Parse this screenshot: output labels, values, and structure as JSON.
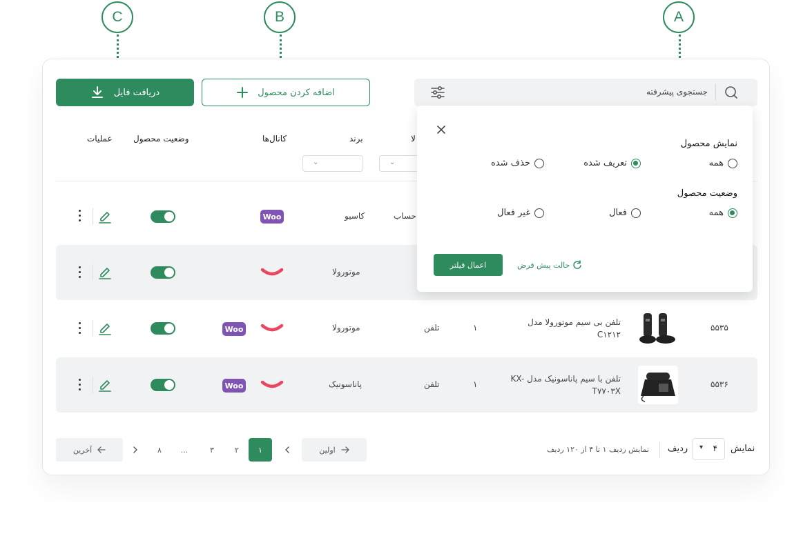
{
  "callouts": {
    "a": "A",
    "b": "B",
    "c": "C"
  },
  "toolbar": {
    "download_label": "دریافت فایل",
    "add_label": "اضافه کردن محصول",
    "search_placeholder": "جستجوی پیشرفته"
  },
  "columns": {
    "operations": "عملیات",
    "status": "وضعیت محصول",
    "channels": "کانال‌ها",
    "brand": "برند",
    "category_partial": "لا"
  },
  "rows": [
    {
      "code": "",
      "name": "",
      "count": "",
      "category": "حساب",
      "brand": "کاسیو",
      "channels": [
        "woocommerce"
      ]
    },
    {
      "code": "",
      "name": "",
      "count": "",
      "category": "",
      "brand": "موتورولا",
      "channels": [
        "smile"
      ]
    },
    {
      "code": "۵۵۳۵",
      "name": "تلفن بی سیم موتورولا مدل C۱۲۱۲",
      "count": "۱",
      "category": "تلفن",
      "brand": "موتورولا",
      "channels": [
        "smile",
        "woocommerce"
      ]
    },
    {
      "code": "۵۵۳۶",
      "name": "تلفن با سیم پاناسونیک مدل KX-T۷۷۰۳X",
      "count": "۱",
      "category": "تلفن",
      "brand": "پاناسونیک",
      "channels": [
        "smile",
        "woocommerce"
      ]
    }
  ],
  "filter": {
    "display_title": "نمایش محصول",
    "display_options": [
      "همه",
      "تعریف شده",
      "حذف شده"
    ],
    "display_selected": "تعریف شده",
    "status_title": "وضعیت محصول",
    "status_options": [
      "همه",
      "فعال",
      "غیر فعال"
    ],
    "status_selected": "همه",
    "apply_label": "اعمال فیلتر",
    "reset_label": "حالت پیش فرض"
  },
  "woo_text": "Woo",
  "pagination": {
    "show_label": "نمایش",
    "rows_value": "۴",
    "row_label": "ردیف",
    "summary": "نمایش ردیف ۱ تا ۴ از ۱۲۰ ردیف",
    "first_label": "اولین",
    "last_label": "آخرین",
    "pages": [
      "۱",
      "۲",
      "۳",
      "...",
      "۸"
    ],
    "active_page": "۱"
  },
  "colors": {
    "accent": "#2e8b5e",
    "woo": "#7f54b3",
    "smile": "#e8475f",
    "row_alt": "#f1f2f4"
  },
  "icons": [
    "download-icon",
    "plus-icon",
    "search-icon",
    "filter-sliders-icon",
    "close-icon",
    "edit-icon",
    "kebab-icon",
    "refresh-icon",
    "arrow-left-icon",
    "arrow-right-icon",
    "chevron-left-icon",
    "chevron-right-icon",
    "chevron-down-icon"
  ]
}
